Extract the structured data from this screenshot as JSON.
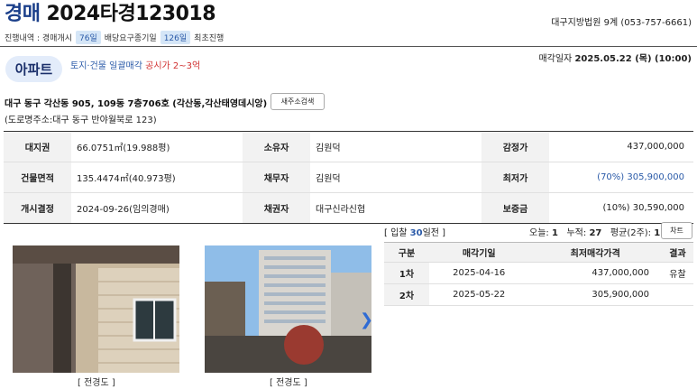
{
  "header": {
    "kind": "경매",
    "case_no": "2024타경123018",
    "court": "대구지방법원 9계 (053-757-6661)"
  },
  "progress": {
    "label": "진행내역 : 경매개시",
    "days1": "76일",
    "step2": "배당요구종기일",
    "days2": "126일",
    "step3": "최초진행"
  },
  "badge": "아파트",
  "sale_type": {
    "text": "토지·건물 일괄매각",
    "note": "공시가 2~3억"
  },
  "sale_date": {
    "label": "매각일자",
    "value": "2025.05.22 (목) (10:00)"
  },
  "address": {
    "main": "대구 동구 각산동 905, 109동 7층706호 (각산동,각산태영데시앙)",
    "road": "(도로명주소:대구 동구 반야월북로 123)",
    "search_btn": "새주소검색"
  },
  "info": [
    {
      "l1": "대지권",
      "v1": "66.0751㎡(19.988평)",
      "l2": "소유자",
      "v2": "김원덕",
      "l3": "감정가",
      "v3": "437,000,000"
    },
    {
      "l1": "건물면적",
      "v1": "135.4474㎡(40.973평)",
      "l2": "채무자",
      "v2": "김원덕",
      "l3": "최저가",
      "v3": "(70%) 305,900,000"
    },
    {
      "l1": "개시결정",
      "v1": "2024-09-26(임의경매)",
      "l2": "채권자",
      "v2": "대구신라신협",
      "l3": "보증금",
      "v3": "(10%) 30,590,000"
    }
  ],
  "stats": {
    "bid_pre": "[ 입찰",
    "bid_days": "30",
    "bid_post": "일전 ]",
    "today_label": "오늘:",
    "today": "1",
    "total_label": "누적:",
    "total": "27",
    "avg_label": "평균(2주):",
    "avg": "1",
    "chart_btn": "차트"
  },
  "history": {
    "headers": [
      "구분",
      "매각기일",
      "최저매각가격",
      "결과"
    ],
    "rows": [
      {
        "round": "1차",
        "date": "2025-04-16",
        "price": "437,000,000",
        "result": "유찰"
      },
      {
        "round": "2차",
        "date": "2025-05-22",
        "price": "305,900,000",
        "result": ""
      }
    ]
  },
  "photos": {
    "caption1": "[ 전경도 ]",
    "caption2": "[ 전경도 ]",
    "next_icon": "chevron-right-icon"
  }
}
